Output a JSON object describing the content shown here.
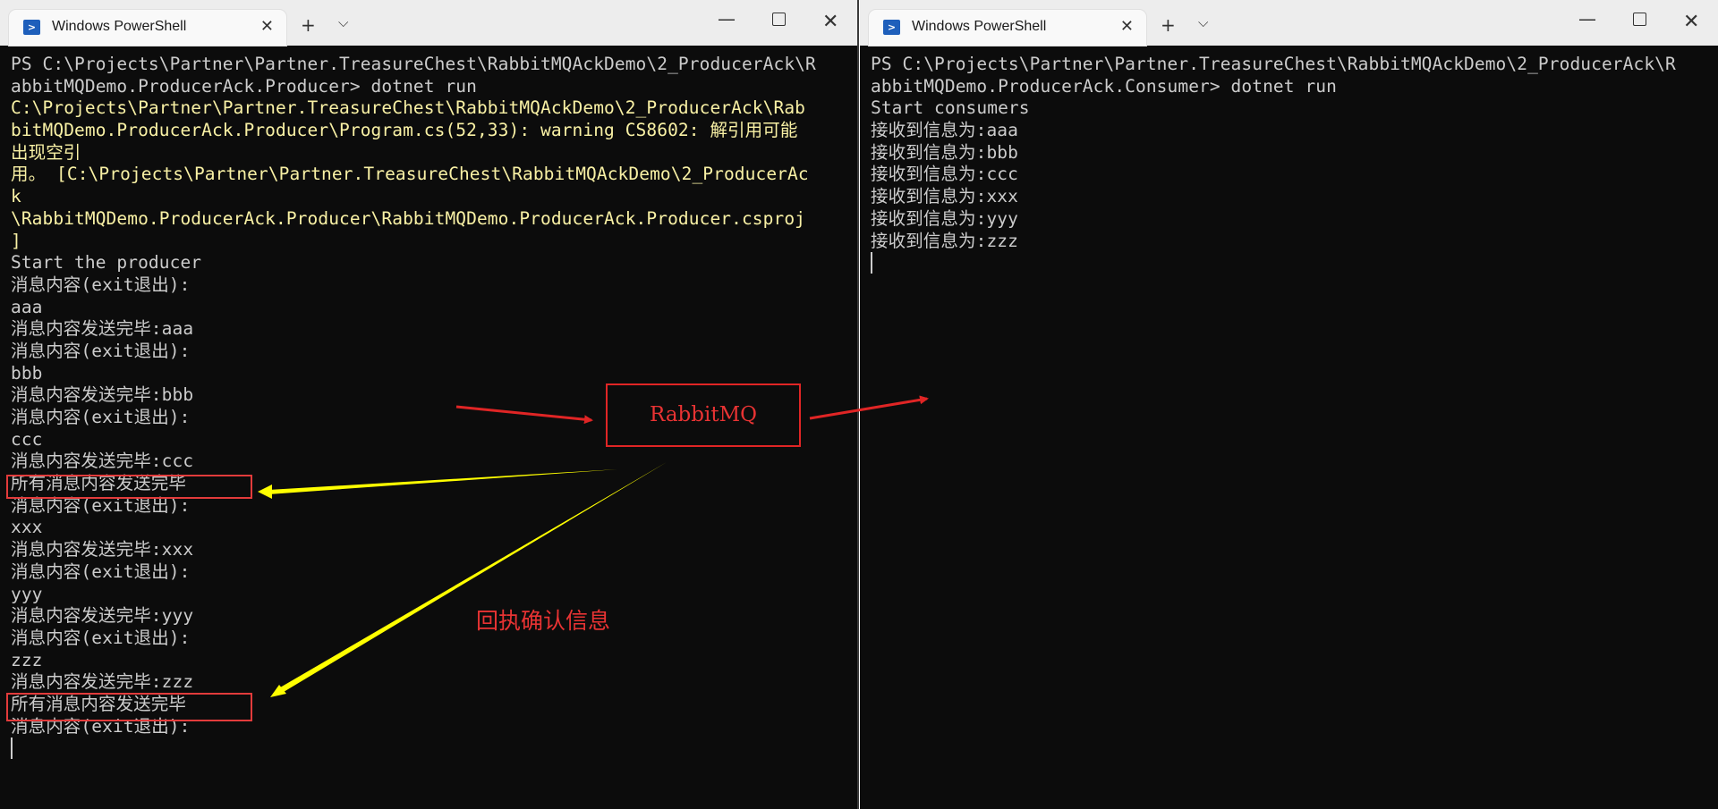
{
  "left_window": {
    "tab_title": "Windows PowerShell",
    "tab_icon": "powershell-icon",
    "lines": [
      {
        "t": "PS C:\\Projects\\Partner\\Partner.TreasureChest\\RabbitMQAckDemo\\2_ProducerAck\\R",
        "c": "gray"
      },
      {
        "t": "abbitMQDemo.ProducerAck.Producer> dotnet run",
        "c": "gray"
      },
      {
        "t": "C:\\Projects\\Partner\\Partner.TreasureChest\\RabbitMQAckDemo\\2_ProducerAck\\Rab",
        "c": "yellow"
      },
      {
        "t": "bitMQDemo.ProducerAck.Producer\\Program.cs(52,33): warning CS8602: 解引用可能",
        "c": "yellow"
      },
      {
        "t": "出现空引",
        "c": "yellow"
      },
      {
        "t": "用。 [C:\\Projects\\Partner\\Partner.TreasureChest\\RabbitMQAckDemo\\2_ProducerAc",
        "c": "yellow"
      },
      {
        "t": "k",
        "c": "yellow"
      },
      {
        "t": "\\RabbitMQDemo.ProducerAck.Producer\\RabbitMQDemo.ProducerAck.Producer.csproj",
        "c": "yellow"
      },
      {
        "t": "]",
        "c": "yellow"
      },
      {
        "t": "Start the producer",
        "c": "gray"
      },
      {
        "t": "消息内容(exit退出):",
        "c": "gray"
      },
      {
        "t": "aaa",
        "c": "gray"
      },
      {
        "t": "消息内容发送完毕:aaa",
        "c": "gray"
      },
      {
        "t": "消息内容(exit退出):",
        "c": "gray"
      },
      {
        "t": "bbb",
        "c": "gray"
      },
      {
        "t": "消息内容发送完毕:bbb",
        "c": "gray"
      },
      {
        "t": "消息内容(exit退出):",
        "c": "gray"
      },
      {
        "t": "ccc",
        "c": "gray"
      },
      {
        "t": "消息内容发送完毕:ccc",
        "c": "gray"
      },
      {
        "t": "所有消息内容发送完毕",
        "c": "gray"
      },
      {
        "t": "消息内容(exit退出):",
        "c": "gray"
      },
      {
        "t": "xxx",
        "c": "gray"
      },
      {
        "t": "消息内容发送完毕:xxx",
        "c": "gray"
      },
      {
        "t": "消息内容(exit退出):",
        "c": "gray"
      },
      {
        "t": "yyy",
        "c": "gray"
      },
      {
        "t": "消息内容发送完毕:yyy",
        "c": "gray"
      },
      {
        "t": "消息内容(exit退出):",
        "c": "gray"
      },
      {
        "t": "zzz",
        "c": "gray"
      },
      {
        "t": "消息内容发送完毕:zzz",
        "c": "gray"
      },
      {
        "t": "所有消息内容发送完毕",
        "c": "gray"
      },
      {
        "t": "消息内容(exit退出):",
        "c": "gray"
      }
    ]
  },
  "right_window": {
    "tab_title": "Windows PowerShell",
    "tab_icon": "powershell-icon",
    "lines": [
      {
        "t": "PS C:\\Projects\\Partner\\Partner.TreasureChest\\RabbitMQAckDemo\\2_ProducerAck\\R",
        "c": "gray"
      },
      {
        "t": "abbitMQDemo.ProducerAck.Consumer> dotnet run",
        "c": "gray"
      },
      {
        "t": "Start consumers",
        "c": "gray"
      },
      {
        "t": "接收到信息为:aaa",
        "c": "gray"
      },
      {
        "t": "接收到信息为:bbb",
        "c": "gray"
      },
      {
        "t": "接收到信息为:ccc",
        "c": "gray"
      },
      {
        "t": "接收到信息为:xxx",
        "c": "gray"
      },
      {
        "t": "接收到信息为:yyy",
        "c": "gray"
      },
      {
        "t": "接收到信息为:zzz",
        "c": "gray"
      }
    ]
  },
  "annotations": {
    "broker_label": "RabbitMQ",
    "ack_label": "回执确认信息",
    "colors": {
      "red": "#e02525",
      "yellow": "#ffff00",
      "console_text": "#cccccc",
      "warning_text": "#f9f1a5",
      "console_bg": "#0c0c0c"
    }
  },
  "titlebar_buttons": [
    "new-tab-icon",
    "dropdown-chevron-icon",
    "minimize-icon",
    "maximize-icon",
    "close-icon"
  ]
}
